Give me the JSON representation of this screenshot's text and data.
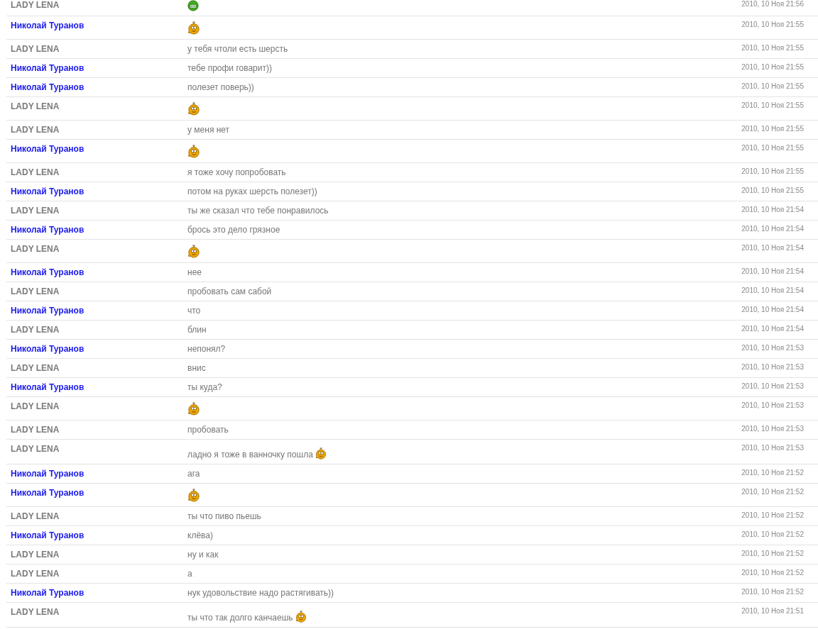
{
  "messages": [
    {
      "author": "LADY LENA",
      "link": false,
      "emoticon": {
        "kind": "grin"
      },
      "time": "2010, 10 Ноя 21:56"
    },
    {
      "author": "Николай Туранов",
      "link": true,
      "emoticon": {
        "kind": "smile"
      },
      "time": "2010, 10 Ноя 21:55"
    },
    {
      "author": "LADY LENA",
      "link": false,
      "text": "у тебя чтоли есть шерсть",
      "time": "2010, 10 Ноя 21:55"
    },
    {
      "author": "Николай Туранов",
      "link": true,
      "text": "тебе профи говарит))",
      "time": "2010, 10 Ноя 21:55"
    },
    {
      "author": "Николай Туранов",
      "link": true,
      "text": "полезет поверь))",
      "time": "2010, 10 Ноя 21:55"
    },
    {
      "author": "LADY LENA",
      "link": false,
      "emoticon": {
        "kind": "smile"
      },
      "time": "2010, 10 Ноя 21:55"
    },
    {
      "author": "LADY LENA",
      "link": false,
      "text": "у меня нет",
      "time": "2010, 10 Ноя 21:55"
    },
    {
      "author": "Николай Туранов",
      "link": true,
      "emoticon": {
        "kind": "smile"
      },
      "time": "2010, 10 Ноя 21:55"
    },
    {
      "author": "LADY LENA",
      "link": false,
      "text": "я тоже хочу попробовать",
      "time": "2010, 10 Ноя 21:55"
    },
    {
      "author": "Николай Туранов",
      "link": true,
      "text": "потом на руках шерсть полезет))",
      "time": "2010, 10 Ноя 21:55"
    },
    {
      "author": "LADY LENA",
      "link": false,
      "text": "ты же сказал что тебе понравилось",
      "time": "2010, 10 Ноя 21:54"
    },
    {
      "author": "Николай Туранов",
      "link": true,
      "text": "брось это дело грязное",
      "time": "2010, 10 Ноя 21:54"
    },
    {
      "author": "LADY LENA",
      "link": false,
      "emoticon": {
        "kind": "smile"
      },
      "time": "2010, 10 Ноя 21:54"
    },
    {
      "author": "Николай Туранов",
      "link": true,
      "text": "нее",
      "time": "2010, 10 Ноя 21:54"
    },
    {
      "author": "LADY LENA",
      "link": false,
      "text": "пробовать сам сабой",
      "time": "2010, 10 Ноя 21:54"
    },
    {
      "author": "Николай Туранов",
      "link": true,
      "text": "что",
      "time": "2010, 10 Ноя 21:54"
    },
    {
      "author": "LADY LENA",
      "link": false,
      "text": "блин",
      "time": "2010, 10 Ноя 21:54"
    },
    {
      "author": "Николай Туранов",
      "link": true,
      "text": "непонял?",
      "time": "2010, 10 Ноя 21:53"
    },
    {
      "author": "LADY LENA",
      "link": false,
      "text": "внис",
      "time": "2010, 10 Ноя 21:53"
    },
    {
      "author": "Николай Туранов",
      "link": true,
      "text": "ты куда?",
      "time": "2010, 10 Ноя 21:53"
    },
    {
      "author": "LADY LENA",
      "link": false,
      "emoticon": {
        "kind": "smile"
      },
      "time": "2010, 10 Ноя 21:53"
    },
    {
      "author": "LADY LENA",
      "link": false,
      "text": "пробовать",
      "time": "2010, 10 Ноя 21:53"
    },
    {
      "author": "LADY LENA",
      "link": false,
      "text": "ладно я тоже в ванночку пошла",
      "emoticon": {
        "kind": "smile"
      },
      "time": "2010, 10 Ноя 21:53"
    },
    {
      "author": "Николай Туранов",
      "link": true,
      "text": "ага",
      "time": "2010, 10 Ноя 21:52"
    },
    {
      "author": "Николай Туранов",
      "link": true,
      "emoticon": {
        "kind": "smile"
      },
      "time": "2010, 10 Ноя 21:52"
    },
    {
      "author": "LADY LENA",
      "link": false,
      "text": "ты что пиво пьешь",
      "time": "2010, 10 Ноя 21:52"
    },
    {
      "author": "Николай Туранов",
      "link": true,
      "text": "клёва)",
      "time": "2010, 10 Ноя 21:52"
    },
    {
      "author": "LADY LENA",
      "link": false,
      "text": "ну и как",
      "time": "2010, 10 Ноя 21:52"
    },
    {
      "author": "LADY LENA",
      "link": false,
      "text": "а",
      "time": "2010, 10 Ноя 21:52"
    },
    {
      "author": "Николай Туранов",
      "link": true,
      "text": "нук удовольствие надо растягивать))",
      "time": "2010, 10 Ноя 21:52"
    },
    {
      "author": "LADY LENA",
      "link": false,
      "text": "ты что так долго канчаешь",
      "emoticon": {
        "kind": "smile"
      },
      "time": "2010, 10 Ноя 21:51"
    }
  ]
}
